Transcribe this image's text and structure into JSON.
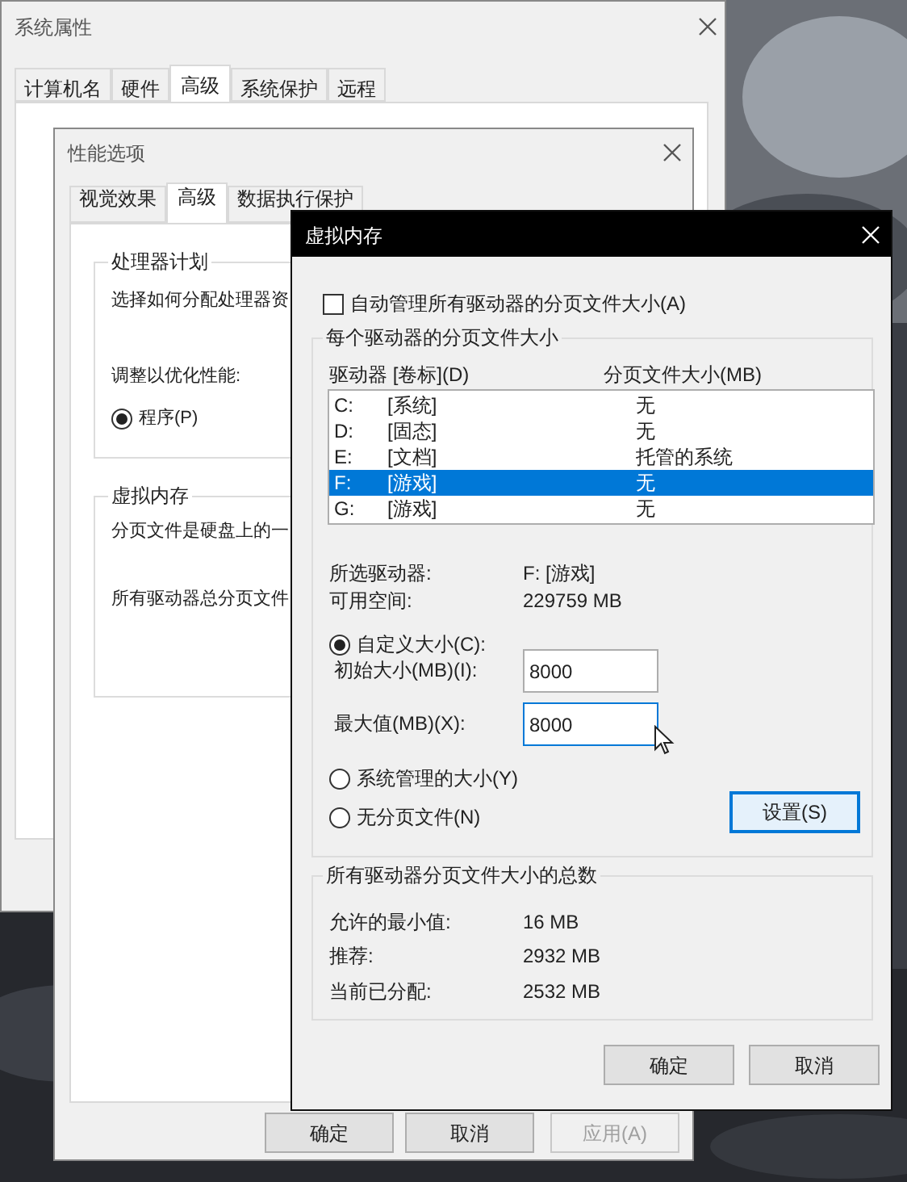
{
  "system_properties": {
    "title": "系统属性",
    "tabs": [
      {
        "label": "计算机名",
        "selected": false
      },
      {
        "label": "硬件",
        "selected": false
      },
      {
        "label": "高级",
        "selected": true
      },
      {
        "label": "系统保护",
        "selected": false
      },
      {
        "label": "远程",
        "selected": false
      }
    ]
  },
  "performance_options": {
    "title": "性能选项",
    "tabs": [
      {
        "label": "视觉效果",
        "selected": false
      },
      {
        "label": "高级",
        "selected": true
      },
      {
        "label": "数据执行保护",
        "selected": false
      }
    ],
    "processor_group": {
      "title": "处理器计划",
      "text": "选择如何分配处理器资",
      "adjust_label": "调整以优化性能:",
      "option": {
        "label": "程序(P)",
        "selected": true
      }
    },
    "vm_group": {
      "title": "虚拟内存",
      "lines": [
        "分页文件是硬盘上的一",
        "所有驱动器总分页文件"
      ]
    },
    "buttons": [
      {
        "label": "确定",
        "disabled": false
      },
      {
        "label": "取消",
        "disabled": false
      },
      {
        "label": "应用(A)",
        "disabled": true
      }
    ]
  },
  "virtual_memory": {
    "title": "虚拟内存",
    "auto_manage": {
      "label": "自动管理所有驱动器的分页文件大小(A)",
      "checked": false
    },
    "per_drive": {
      "title": "每个驱动器的分页文件大小",
      "columns": [
        "驱动器 [卷标](D)",
        "分页文件大小(MB)"
      ],
      "drives": [
        {
          "letter": "C:",
          "label": "[系统]",
          "size": "无",
          "selected": false
        },
        {
          "letter": "D:",
          "label": "[固态]",
          "size": "无",
          "selected": false
        },
        {
          "letter": "E:",
          "label": "[文档]",
          "size": "托管的系统",
          "selected": false
        },
        {
          "letter": "F:",
          "label": "[游戏]",
          "size": "无",
          "selected": true
        },
        {
          "letter": "G:",
          "label": "[游戏]",
          "size": "无",
          "selected": false
        }
      ],
      "selected_drive": {
        "label": "所选驱动器:",
        "value": "F:  [游戏]"
      },
      "free_space": {
        "label": "可用空间:",
        "value": "229759 MB"
      },
      "custom_size": {
        "label": "自定义大小(C):",
        "selected": true
      },
      "initial_size": {
        "label": "初始大小(MB)(I):",
        "value": "8000",
        "focused": false
      },
      "max_size": {
        "label": "最大值(MB)(X):",
        "value": "8000",
        "focused": true
      },
      "system_managed": {
        "label": "系统管理的大小(Y)",
        "selected": false
      },
      "no_paging": {
        "label": "无分页文件(N)",
        "selected": false
      },
      "set_button": "设置(S)"
    },
    "totals": {
      "title": "所有驱动器分页文件大小的总数",
      "rows": [
        {
          "label": "允许的最小值:",
          "value": "16 MB"
        },
        {
          "label": "推荐:",
          "value": "2932 MB"
        },
        {
          "label": "当前已分配:",
          "value": "2532 MB"
        }
      ]
    },
    "buttons": [
      "确定",
      "取消"
    ]
  }
}
